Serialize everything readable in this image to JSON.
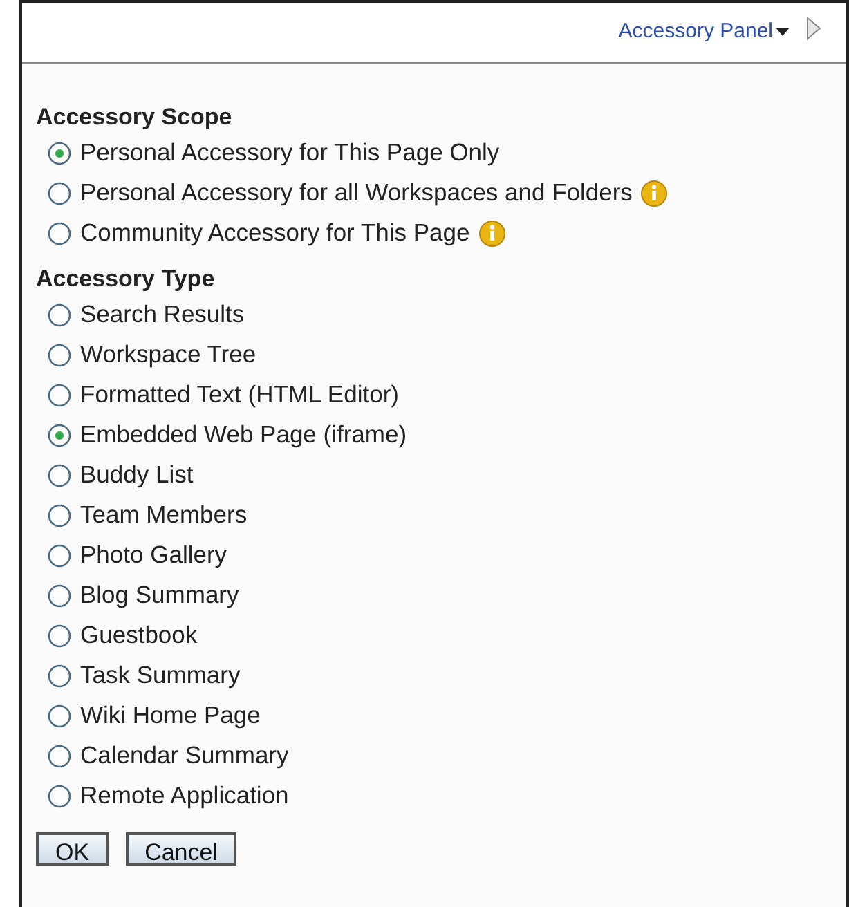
{
  "header": {
    "menu_label": "Accessory Panel"
  },
  "sections": [
    {
      "title": "Accessory Scope",
      "options": [
        {
          "label": "Personal Accessory for This Page Only",
          "selected": true,
          "info": false
        },
        {
          "label": "Personal Accessory for all Workspaces and Folders",
          "selected": false,
          "info": true
        },
        {
          "label": "Community Accessory for This Page",
          "selected": false,
          "info": true
        }
      ]
    },
    {
      "title": "Accessory Type",
      "options": [
        {
          "label": "Search Results",
          "selected": false,
          "info": false
        },
        {
          "label": "Workspace Tree",
          "selected": false,
          "info": false
        },
        {
          "label": "Formatted Text (HTML Editor)",
          "selected": false,
          "info": false
        },
        {
          "label": "Embedded Web Page (iframe)",
          "selected": true,
          "info": false
        },
        {
          "label": "Buddy List",
          "selected": false,
          "info": false
        },
        {
          "label": "Team Members",
          "selected": false,
          "info": false
        },
        {
          "label": "Photo Gallery",
          "selected": false,
          "info": false
        },
        {
          "label": "Blog Summary",
          "selected": false,
          "info": false
        },
        {
          "label": "Guestbook",
          "selected": false,
          "info": false
        },
        {
          "label": "Task Summary",
          "selected": false,
          "info": false
        },
        {
          "label": "Wiki Home Page",
          "selected": false,
          "info": false
        },
        {
          "label": "Calendar Summary",
          "selected": false,
          "info": false
        },
        {
          "label": "Remote Application",
          "selected": false,
          "info": false
        }
      ]
    }
  ],
  "buttons": [
    "OK",
    "Cancel"
  ]
}
